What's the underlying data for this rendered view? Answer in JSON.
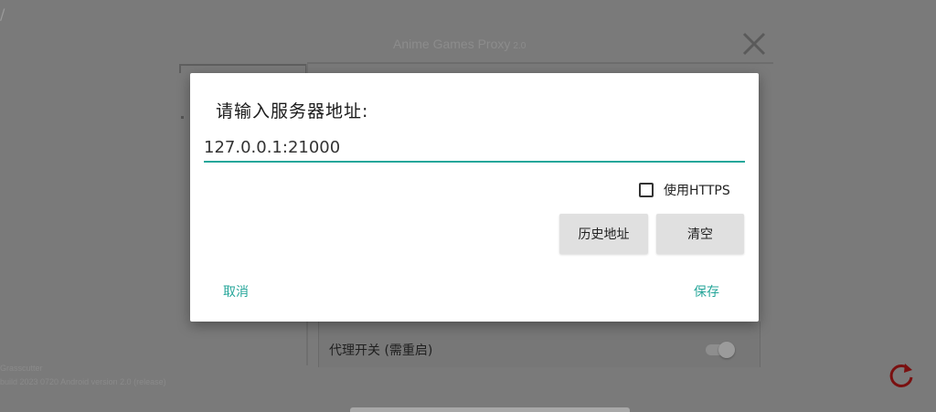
{
  "background": {
    "app_title": "Anime Games Proxy",
    "app_version": "2.0",
    "proxy_toggle_label": "代理开关 (需重启)",
    "proxy_toggle_on": false,
    "footer_line_1": "Grasscutter ",
    "footer_line_2": "build 2023 0720 Android version 2.0 (release)"
  },
  "dialog": {
    "title": "请输入服务器地址:",
    "server_input_value": "127.0.0.1:21000",
    "https_label": "使用HTTPS",
    "https_checked": false,
    "history_button_label": "历史地址",
    "clear_button_label": "清空",
    "cancel_label": "取消",
    "save_label": "保存"
  },
  "colors": {
    "accent": "#26a69a",
    "overlay": "#7a7a7a",
    "refresh_icon": "#7a1010"
  },
  "icons": {
    "close": "close-icon",
    "refresh": "refresh-icon",
    "checkbox": "checkbox-icon"
  }
}
